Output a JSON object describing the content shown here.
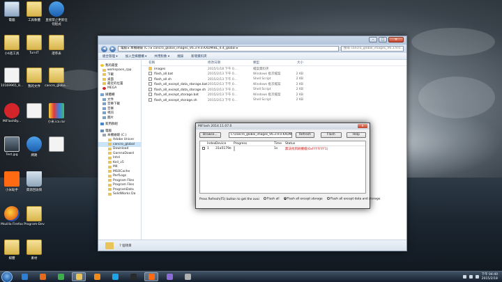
{
  "desktop": {
    "icons": [
      {
        "label": "電腦",
        "icon": "computer-icon",
        "kind": "pc"
      },
      {
        "label": "工具軟體",
        "icon": "folder-icon",
        "kind": "folder"
      },
      {
        "label": "直接禁止更新任何程式",
        "icon": "globe-icon",
        "kind": "blue"
      },
      {
        "label": "小4進工具",
        "icon": "folder-icon",
        "kind": "folder"
      },
      {
        "label": "TurnIT",
        "icon": "folder-icon",
        "kind": "folder"
      },
      {
        "label": "證券表",
        "icon": "folder-icon",
        "kind": "folder"
      },
      {
        "label": "10169965_8...",
        "icon": "image-icon",
        "kind": "doc"
      },
      {
        "label": "我的文件",
        "icon": "folder-icon",
        "kind": "folder"
      },
      {
        "label": "cancro_globa...",
        "icon": "folder-icon",
        "kind": "folder"
      },
      {
        "label": "MiFlashBy...",
        "icon": "miflash-icon",
        "kind": "red"
      },
      {
        "label": "",
        "icon": "app-icon",
        "kind": "doc"
      },
      {
        "label": "小米.ico.rar",
        "icon": "archive-icon",
        "kind": "pic2"
      },
      {
        "label": "Test.jpg",
        "icon": "image-icon",
        "kind": "pic"
      },
      {
        "label": "網路",
        "icon": "network-icon",
        "kind": "blue"
      },
      {
        "label": "",
        "icon": "screenshot-icon",
        "kind": "doc"
      },
      {
        "label": "小米助手",
        "icon": "mi-icon",
        "kind": "orange"
      },
      {
        "label": "資源回收筒",
        "icon": "recycle-bin-icon",
        "kind": "trash"
      },
      {
        "label": "Mozilla Firefox",
        "icon": "firefox-icon",
        "kind": "firefox"
      },
      {
        "label": "Program-Dev",
        "icon": "folder-icon",
        "kind": "folder"
      },
      {
        "label": "媒體",
        "icon": "folder-icon",
        "kind": "folder"
      },
      {
        "label": "素材",
        "icon": "folder-icon",
        "kind": "folder"
      }
    ]
  },
  "explorer": {
    "address": "電腦 ▸ 本機磁碟 (C:) ▸ cancro_global_images_V6.3.9.0.KXDMIBL_4.4_global ▸",
    "search_placeholder": "搜尋 cancro_global_images_V6.3.9.0...",
    "toolbar": [
      "組合管理 ▾",
      "加入至媒體櫃 ▾",
      "共用對象 ▾",
      "燒錄",
      "新增資料夾"
    ],
    "columns": {
      "name": "名稱",
      "date": "修改日期",
      "type": "類型",
      "size": "大小"
    },
    "nav": [
      {
        "label": "我的最愛",
        "kind": "star",
        "level": "group"
      },
      {
        "label": "workspace_cpp",
        "kind": "folder",
        "level": "item"
      },
      {
        "label": "下載",
        "kind": "folder",
        "level": "item"
      },
      {
        "label": "桌面",
        "kind": "folder",
        "level": "item"
      },
      {
        "label": "最近的位置",
        "kind": "folder",
        "level": "item"
      },
      {
        "label": "MEGA",
        "kind": "red",
        "level": "item"
      },
      {
        "label": "媒體櫃",
        "kind": "lib",
        "level": "group"
      },
      {
        "label": "文件",
        "kind": "lib",
        "level": "item"
      },
      {
        "label": "音樂下載",
        "kind": "lib",
        "level": "item"
      },
      {
        "label": "音樂",
        "kind": "lib",
        "level": "item"
      },
      {
        "label": "視訊",
        "kind": "lib",
        "level": "item"
      },
      {
        "label": "圖片",
        "kind": "lib",
        "level": "item"
      },
      {
        "label": "家用群組",
        "kind": "net",
        "level": "group"
      },
      {
        "label": "電腦",
        "kind": "pc",
        "level": "group"
      },
      {
        "label": "本機磁碟 (C:)",
        "kind": "drive",
        "level": "item"
      },
      {
        "label": "Adobe Univer",
        "kind": "folder",
        "level": "sub"
      },
      {
        "label": "cancro_global",
        "kind": "folder",
        "level": "sub",
        "selected": true
      },
      {
        "label": "Download",
        "kind": "folder",
        "level": "sub"
      },
      {
        "label": "GarenaDownl",
        "kind": "folder",
        "level": "sub"
      },
      {
        "label": "Intel",
        "kind": "folder",
        "level": "sub"
      },
      {
        "label": "Keil_v5",
        "kind": "folder",
        "level": "sub"
      },
      {
        "label": "M4",
        "kind": "folder",
        "level": "sub"
      },
      {
        "label": "MSOCache",
        "kind": "folder",
        "level": "sub"
      },
      {
        "label": "PerfLogs",
        "kind": "folder",
        "level": "sub"
      },
      {
        "label": "Program Files",
        "kind": "folder",
        "level": "sub"
      },
      {
        "label": "Program Files",
        "kind": "folder",
        "level": "sub"
      },
      {
        "label": "ProgramData",
        "kind": "folder",
        "level": "sub"
      },
      {
        "label": "SolidWorks Da",
        "kind": "folder",
        "level": "sub"
      }
    ],
    "files": [
      {
        "name": "images",
        "date": "2015/1/18 下午 0...",
        "type": "檔案資料夾",
        "size": "",
        "kind": "folder"
      },
      {
        "name": "flash_all.bat",
        "date": "2015/2/13 下午 0...",
        "type": "Windows 批次檔案",
        "size": "2 KB",
        "kind": "script"
      },
      {
        "name": "flash_all.sh",
        "date": "2015/2/13 下午 0...",
        "type": "Shell Script",
        "size": "2 KB",
        "kind": "script"
      },
      {
        "name": "flash_all_except_data_storage.bat",
        "date": "2015/2/13 下午 0...",
        "type": "Windows 批次檔案",
        "size": "2 KB",
        "kind": "script"
      },
      {
        "name": "flash_all_except_data_storage.sh",
        "date": "2015/2/13 下午 0...",
        "type": "Shell Script",
        "size": "2 KB",
        "kind": "script"
      },
      {
        "name": "flash_all_except_storage.bat",
        "date": "2015/2/13 下午 0...",
        "type": "Windows 批次檔案",
        "size": "2 KB",
        "kind": "script"
      },
      {
        "name": "flash_all_except_storage.sh",
        "date": "2015/2/13 下午 0...",
        "type": "Shell Script",
        "size": "2 KB",
        "kind": "script"
      }
    ],
    "status": "7 個項目"
  },
  "miflash": {
    "title": "MiFlash 2014.11.07.0",
    "browse": "Browse...",
    "path": "C:\\cancro_global_images_V6.3.9.0.KXDMIBL_4.4_global",
    "refresh": "Refresh",
    "flash": "Flash",
    "help": "Help",
    "columns": {
      "index": "Index",
      "device": "Device",
      "progress": "Progress",
      "time": "Time",
      "status": "Status"
    },
    "rows": [
      {
        "index": "1",
        "device": "31a5179e",
        "progress": 0.0,
        "time": "1s",
        "status": "無法找到刷機檔(0xFFFFFFF1)"
      }
    ],
    "footer_hint": "Press Refresh(F5) button to get the avai",
    "options": [
      {
        "label": "Flash all",
        "selected": false
      },
      {
        "label": "Flash all except storage",
        "selected": true
      },
      {
        "label": "Flash all except data and storage",
        "selected": false
      }
    ]
  },
  "taskbar": {
    "items": [
      {
        "name": "ie",
        "color": "#2d7fd3",
        "active": false
      },
      {
        "name": "firefox",
        "color": "#e66a1a",
        "active": false
      },
      {
        "name": "chrome",
        "color": "#3cae4a",
        "active": false
      },
      {
        "name": "explorer",
        "color": "#e8c45a",
        "active": true
      },
      {
        "name": "media-player",
        "color": "#f08a1c",
        "active": false
      },
      {
        "name": "skype",
        "color": "#1fa3e8",
        "active": false
      },
      {
        "name": "cmd",
        "color": "#2a2a2a",
        "active": false
      },
      {
        "name": "mi",
        "color": "#ff6a13",
        "active": true
      },
      {
        "name": "app",
        "color": "#8a6bd8",
        "active": false
      },
      {
        "name": "tools",
        "color": "#b0b0b0",
        "active": false
      }
    ],
    "time": "下午 04:40",
    "date": "2015/2/18"
  }
}
